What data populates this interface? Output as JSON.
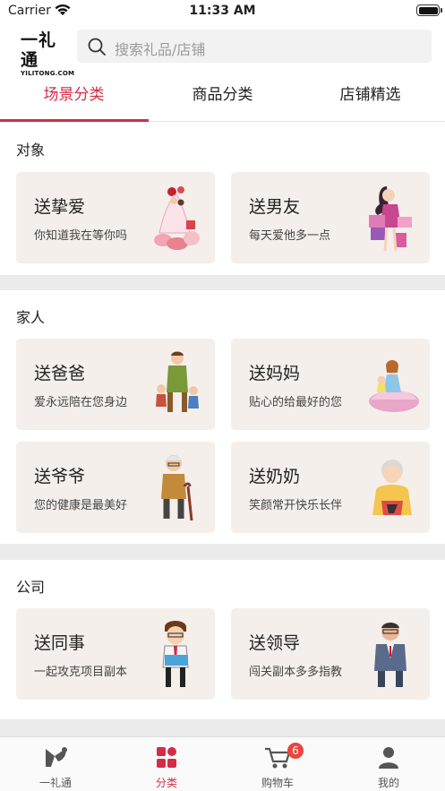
{
  "status_bar": {
    "carrier": "Carrier",
    "time": "11:33 AM"
  },
  "header": {
    "logo_text": "一礼通",
    "logo_sub": "YILITONG.COM",
    "search_placeholder": "搜索礼品/店铺"
  },
  "tabs": [
    {
      "label": "场景分类",
      "active": true
    },
    {
      "label": "商品分类",
      "active": false
    },
    {
      "label": "店铺精选",
      "active": false
    }
  ],
  "sections": [
    {
      "title": "对象",
      "cards": [
        {
          "title": "送挚爱",
          "subtitle": "你知道我在等你吗",
          "icon": "lovers-gift-illustration"
        },
        {
          "title": "送男友",
          "subtitle": "每天爱他多一点",
          "icon": "girl-with-gifts-illustration"
        }
      ]
    },
    {
      "title": "家人",
      "cards": [
        {
          "title": "送爸爸",
          "subtitle": "爱永远陪在您身边",
          "icon": "father-with-kids-illustration"
        },
        {
          "title": "送妈妈",
          "subtitle": "贴心的给最好的您",
          "icon": "mother-with-child-illustration"
        },
        {
          "title": "送爷爷",
          "subtitle": "您的健康是最美好",
          "icon": "grandpa-with-cane-illustration"
        },
        {
          "title": "送奶奶",
          "subtitle": "笑颜常开快乐长伴",
          "icon": "grandma-illustration"
        }
      ]
    },
    {
      "title": "公司",
      "cards": [
        {
          "title": "送同事",
          "subtitle": "一起攻克项目副本",
          "icon": "colleague-illustration"
        },
        {
          "title": "送领导",
          "subtitle": "闯关副本多多指教",
          "icon": "boss-illustration"
        }
      ]
    }
  ],
  "tabbar": [
    {
      "label": "一礼通",
      "icon": "home-logo-icon",
      "active": false
    },
    {
      "label": "分类",
      "icon": "category-icon",
      "active": true
    },
    {
      "label": "购物车",
      "icon": "cart-icon",
      "active": false,
      "badge": "6"
    },
    {
      "label": "我的",
      "icon": "profile-icon",
      "active": false
    }
  ],
  "colors": {
    "accent": "#d62b45",
    "card_bg": "#f4efeb",
    "badge": "#e8463e"
  }
}
